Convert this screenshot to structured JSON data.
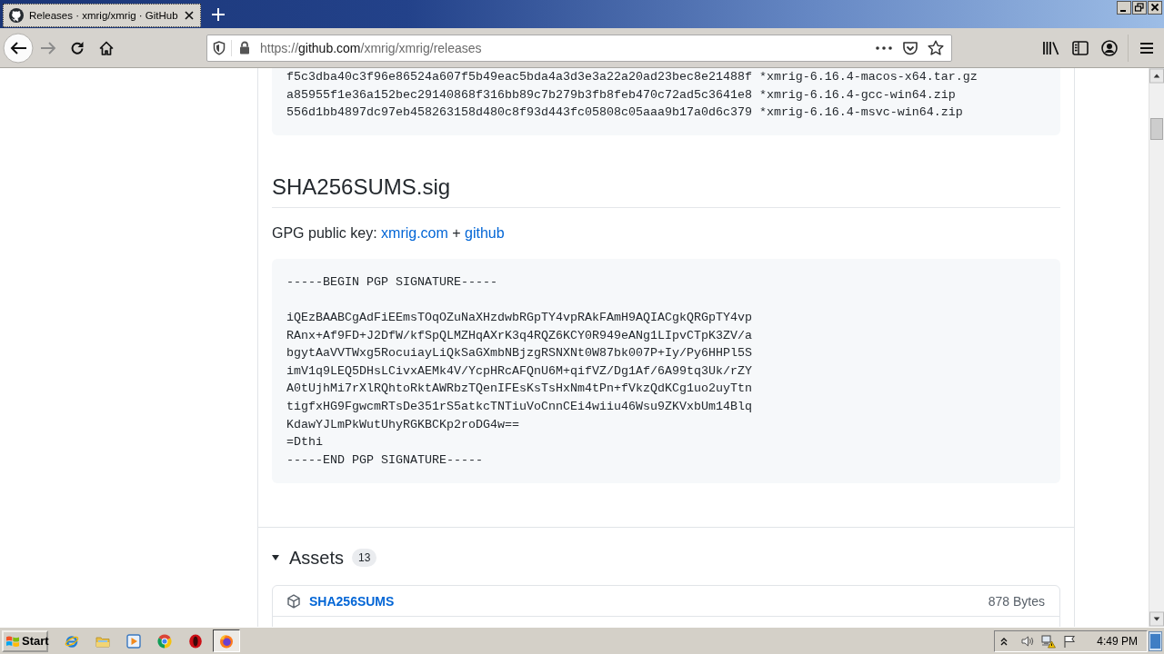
{
  "tabs": [
    {
      "title": "Releases · xmrig/xmrig · GitHub",
      "selected": true
    }
  ],
  "address_bar": {
    "scheme": "https://",
    "host": "github.com",
    "path": "/xmrig/xmrig/releases"
  },
  "checksums": {
    "lines": [
      "f5c3dba40c3f96e86524a607f5b49eac5bda4a3d3e3a22a20ad23bec8e21488f *xmrig-6.16.4-macos-x64.tar.gz",
      "a85955f1e36a152bec29140868f316bb89c7b279b3fb8feb470c72ad5c3641e8 *xmrig-6.16.4-gcc-win64.zip",
      "556d1bb4897dc97eb458263158d480c8f93d443fc05808c05aaa9b17a0d6c379 *xmrig-6.16.4-msvc-win64.zip"
    ]
  },
  "signature": {
    "heading": "SHA256SUMS.sig",
    "key_label": "GPG public key:",
    "key_links": [
      "xmrig.com",
      "github"
    ],
    "key_joiner": "+",
    "pgp_begin": "-----BEGIN PGP SIGNATURE-----",
    "pgp_lines": [
      "iQEzBAABCgAdFiEEmsTOqOZuNaXHzdwbRGpTY4vpRAkFAmH9AQIACgkQRGpTY4vp",
      "RAnx+Af9FD+J2DfW/kfSpQLMZHqAXrK3q4RQZ6KCY0R949eANg1LIpvCTpK3ZV/a",
      "bgytAaVVTWxg5RocuiayLiQkSaGXmbNBjzgRSNXNt0W87bk007P+Iy/Py6HHPl5S",
      "imV1q9LEQ5DHsLCivxAEMk4V/YcpHRcAFQnU6M+qifVZ/Dg1Af/6A99tq3Uk/rZY",
      "A0tUjhMi7rXlRQhtoRktAWRbzTQenIFEsKsTsHxNm4tPn+fVkzQdKCg1uo2uyTtn",
      "tigfxHG9FgwcmRTsDe351rS5atkcTNTiuVoCnnCEi4wiiu46Wsu9ZKVxbUm14Blq",
      "KdawYJLmPkWutUhyRGKBCKp2roDG4w==",
      "=Dthi"
    ],
    "pgp_end": "-----END PGP SIGNATURE-----"
  },
  "assets": {
    "title": "Assets",
    "count": "13",
    "expanded": true,
    "items": [
      {
        "name": "SHA256SUMS",
        "size": "878 Bytes"
      }
    ]
  },
  "taskbar": {
    "start": "Start",
    "apps": [
      {
        "kind": "orbit",
        "active": false
      },
      {
        "kind": "folder",
        "active": false
      },
      {
        "kind": "player",
        "active": false
      },
      {
        "kind": "segmented",
        "active": false
      },
      {
        "kind": "ring",
        "active": false
      },
      {
        "kind": "flame",
        "active": true
      }
    ],
    "clock": "4:49 PM"
  }
}
